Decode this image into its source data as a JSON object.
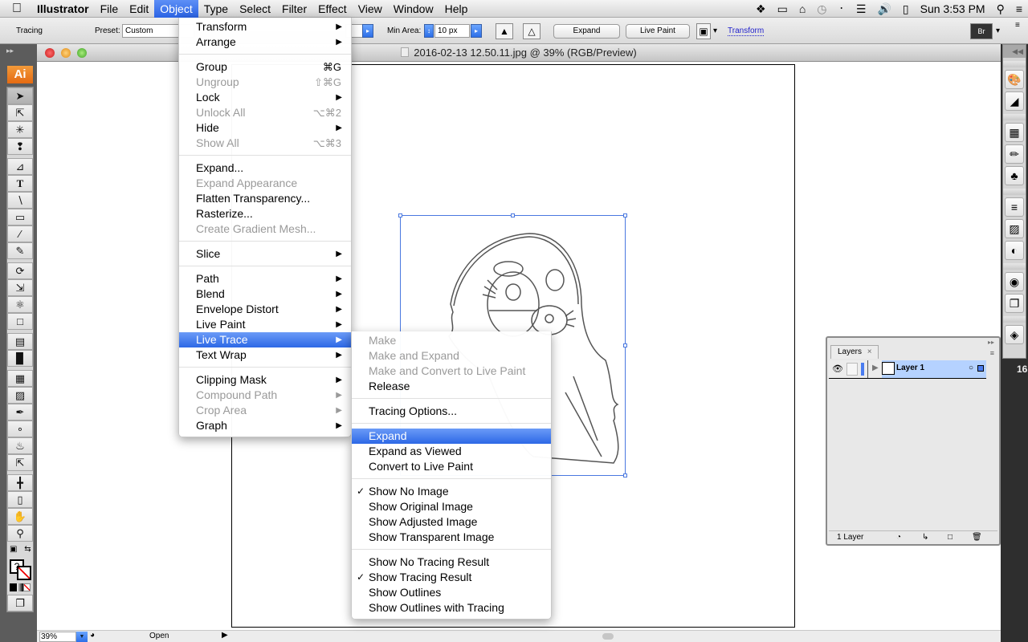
{
  "menubar": {
    "app_name": "Illustrator",
    "items": [
      "File",
      "Edit",
      "Object",
      "Type",
      "Select",
      "Filter",
      "Effect",
      "View",
      "Window",
      "Help"
    ],
    "active_item": "Object",
    "clock": "Sun 3:53 PM",
    "status_icons": [
      "dropbox-icon",
      "airplay-icon",
      "home-sharing-icon",
      "time-machine-icon",
      "bluetooth-icon",
      "wifi-icon",
      "volume-icon",
      "battery-icon",
      "spotlight-icon",
      "notification-list-icon"
    ]
  },
  "controlbar": {
    "context_label": "Tracing",
    "preset_label": "Preset:",
    "preset_value": "Custom",
    "min_area_label": "Min Area:",
    "min_area_value": "10 px",
    "expand_button": "Expand",
    "live_paint_button": "Live Paint",
    "transform_link": "Transform"
  },
  "document": {
    "title": "2016-02-13 12.50.11.jpg @ 39% (RGB/Preview)",
    "zoom_value": "39%",
    "status_text": "Open"
  },
  "object_menu": {
    "items": [
      {
        "label": "Transform",
        "submenu": true
      },
      {
        "label": "Arrange",
        "submenu": true
      },
      {
        "sep": true
      },
      {
        "label": "Group",
        "shortcut": "⌘G"
      },
      {
        "label": "Ungroup",
        "shortcut": "⇧⌘G",
        "disabled": true
      },
      {
        "label": "Lock",
        "submenu": true
      },
      {
        "label": "Unlock All",
        "shortcut": "⌥⌘2",
        "disabled": true
      },
      {
        "label": "Hide",
        "submenu": true
      },
      {
        "label": "Show All",
        "shortcut": "⌥⌘3",
        "disabled": true
      },
      {
        "sep": true
      },
      {
        "label": "Expand..."
      },
      {
        "label": "Expand Appearance",
        "disabled": true
      },
      {
        "label": "Flatten Transparency..."
      },
      {
        "label": "Rasterize..."
      },
      {
        "label": "Create Gradient Mesh...",
        "disabled": true
      },
      {
        "sep": true
      },
      {
        "label": "Slice",
        "submenu": true
      },
      {
        "sep": true
      },
      {
        "label": "Path",
        "submenu": true
      },
      {
        "label": "Blend",
        "submenu": true
      },
      {
        "label": "Envelope Distort",
        "submenu": true
      },
      {
        "label": "Live Paint",
        "submenu": true
      },
      {
        "label": "Live Trace",
        "submenu": true,
        "highlighted": true
      },
      {
        "label": "Text Wrap",
        "submenu": true
      },
      {
        "sep": true
      },
      {
        "label": "Clipping Mask",
        "submenu": true
      },
      {
        "label": "Compound Path",
        "submenu": true,
        "disabled": true
      },
      {
        "label": "Crop Area",
        "submenu": true,
        "disabled": true
      },
      {
        "label": "Graph",
        "submenu": true
      }
    ]
  },
  "live_trace_submenu": {
    "items": [
      {
        "label": "Make",
        "disabled": true
      },
      {
        "label": "Make and Expand",
        "disabled": true
      },
      {
        "label": "Make and Convert to Live Paint",
        "disabled": true
      },
      {
        "label": "Release"
      },
      {
        "sep": true
      },
      {
        "label": "Tracing Options..."
      },
      {
        "sep": true
      },
      {
        "label": "Expand",
        "highlighted": true
      },
      {
        "label": "Expand as Viewed"
      },
      {
        "label": "Convert to Live Paint"
      },
      {
        "sep": true
      },
      {
        "label": "Show No Image",
        "checked": true
      },
      {
        "label": "Show Original Image"
      },
      {
        "label": "Show Adjusted Image"
      },
      {
        "label": "Show Transparent Image"
      },
      {
        "sep": true
      },
      {
        "label": "Show No Tracing Result"
      },
      {
        "label": "Show Tracing Result",
        "checked": true
      },
      {
        "label": "Show Outlines"
      },
      {
        "label": "Show Outlines with Tracing"
      }
    ]
  },
  "tools": [
    "selection-tool",
    "direct-selection-tool",
    "magic-wand-tool",
    "lasso-tool",
    "pen-tool",
    "type-tool",
    "line-segment-tool",
    "rectangle-tool",
    "paintbrush-tool",
    "pencil-tool",
    "rotate-tool",
    "scale-tool",
    "warp-tool",
    "free-transform-tool",
    "symbol-sprayer-tool",
    "column-graph-tool",
    "mesh-tool",
    "gradient-tool",
    "eyedropper-tool",
    "blend-tool",
    "live-paint-bucket-tool",
    "live-paint-selection-tool",
    "slice-tool",
    "eraser-tool",
    "hand-tool",
    "zoom-tool"
  ],
  "tools_logo": "Ai",
  "layers_panel": {
    "tab_label": "Layers",
    "layers": [
      {
        "name": "Layer 1",
        "visible": true,
        "color": "#4a7cf0"
      }
    ],
    "footer_count": "1 Layer"
  },
  "right_dock_icons": [
    "color-icon",
    "color-guide-icon",
    "swatches-icon",
    "brushes-icon",
    "symbols-icon",
    "stroke-icon",
    "gradient-icon",
    "transparency-icon",
    "appearance-icon",
    "graphic-styles-icon",
    "layers-icon"
  ],
  "edge_label": "16"
}
